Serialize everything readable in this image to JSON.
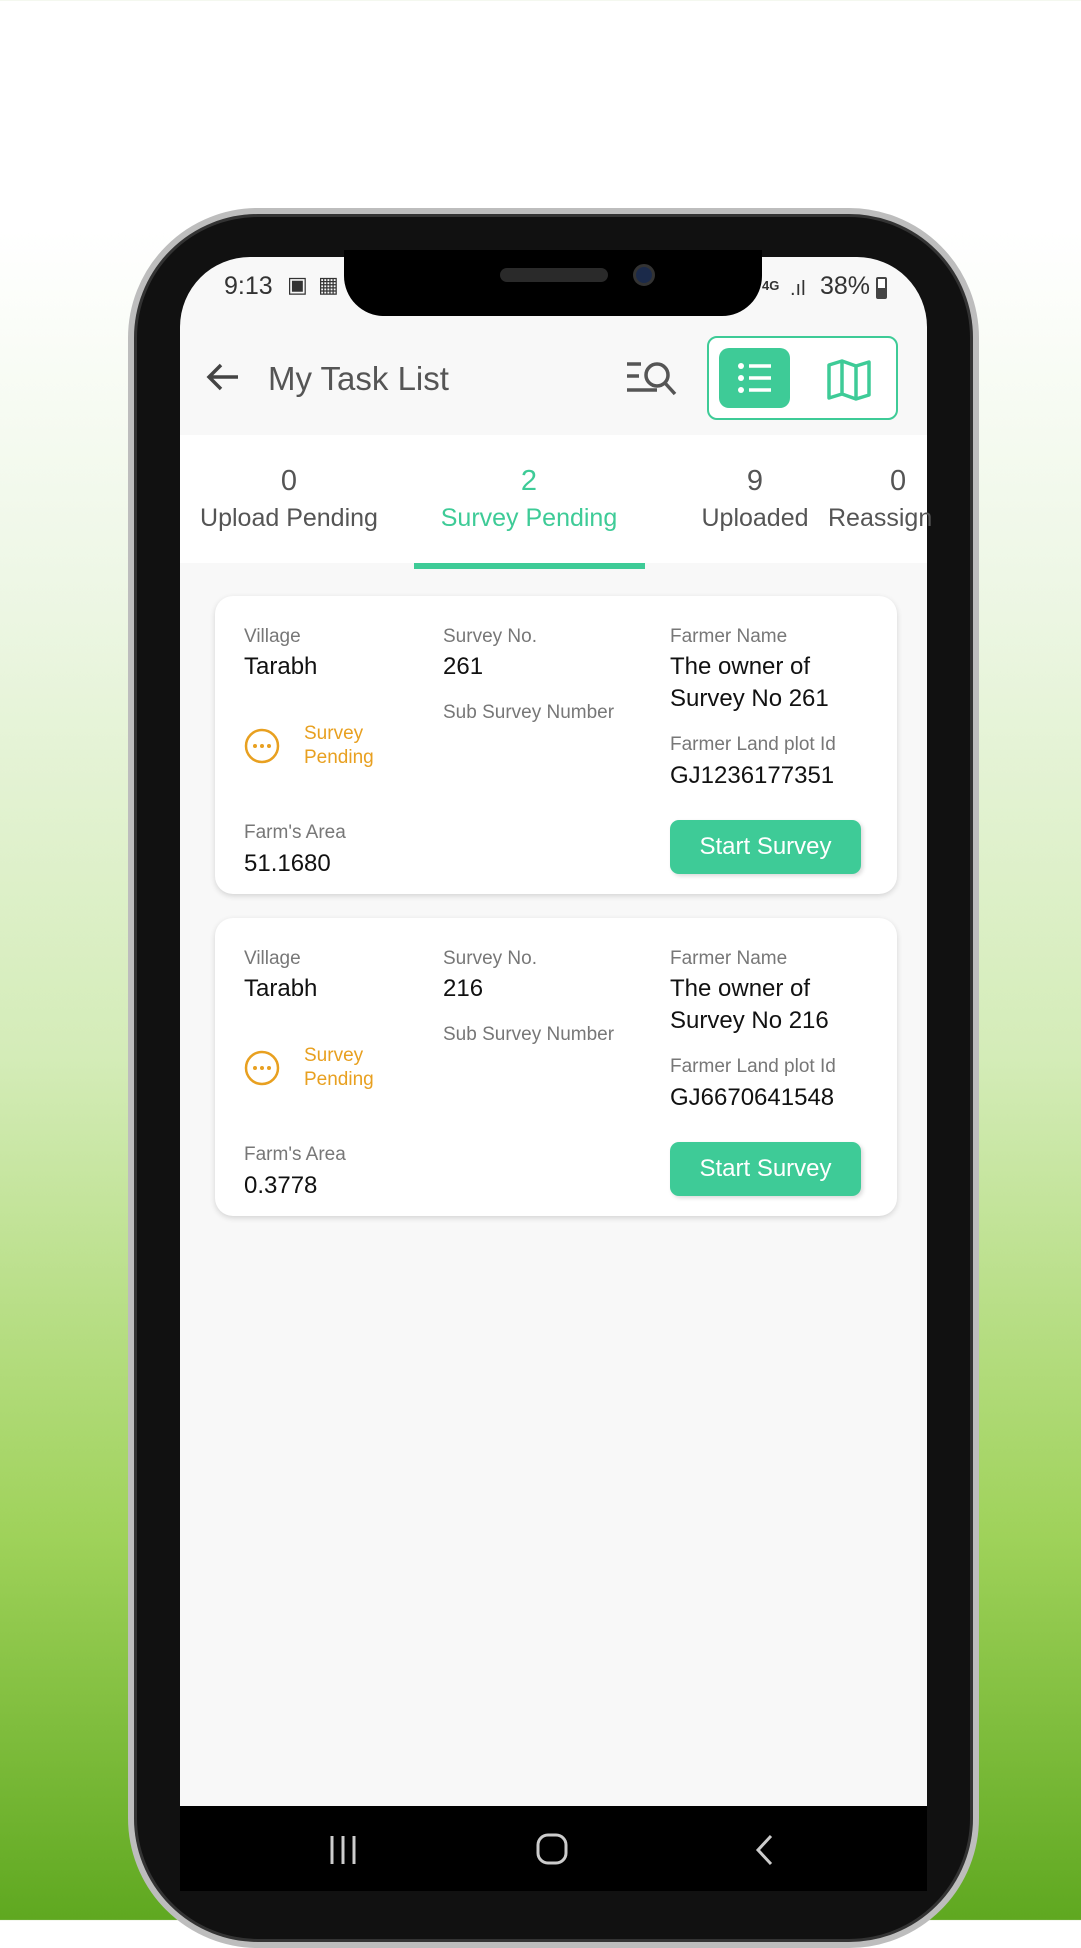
{
  "status_bar": {
    "time": "9:13",
    "network": "4G",
    "battery": "38%"
  },
  "header": {
    "title": "My Task List",
    "active_view": "list"
  },
  "tabs": [
    {
      "count": "0",
      "label": "Upload Pending"
    },
    {
      "count": "2",
      "label": "Survey Pending",
      "active": true
    },
    {
      "count": "9",
      "label": "Uploaded"
    },
    {
      "count": "0",
      "label": "Reassign"
    }
  ],
  "labels": {
    "village": "Village",
    "survey_no": "Survey No.",
    "sub_survey": "Sub Survey Number",
    "farmer_name": "Farmer Name",
    "plot_id": "Farmer Land plot Id",
    "area": "Farm's Area",
    "status1": "Survey",
    "status2": "Pending",
    "button": "Start Survey"
  },
  "tasks": [
    {
      "village": "Tarabh",
      "survey_no": "261",
      "farmer_name_1": "The owner of",
      "farmer_name_2": "Survey No 261",
      "plot_id": "GJ1236177351",
      "area": "51.1680"
    },
    {
      "village": "Tarabh",
      "survey_no": "216",
      "farmer_name_1": "The owner of",
      "farmer_name_2": "Survey No 216",
      "plot_id": "GJ6670641548",
      "area": "0.3778"
    }
  ],
  "colors": {
    "accent": "#3ecb97",
    "pending": "#e8a020"
  }
}
